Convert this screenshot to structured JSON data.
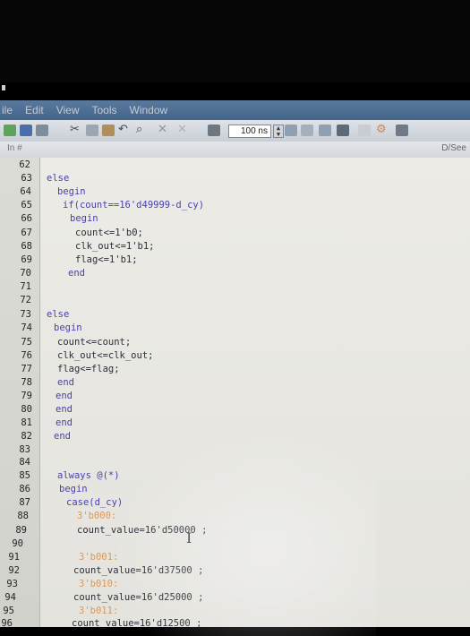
{
  "menubar": {
    "items": [
      "ile",
      "Edit",
      "View",
      "Tools",
      "Window"
    ]
  },
  "toolbar": {
    "time_value": "100 ns",
    "page_label": "D/See"
  },
  "pathbar": {
    "left": "In #"
  },
  "colors": {
    "keyword": "#4a3fb0",
    "number": "#b24a4a",
    "case_label": "#d79a5e",
    "editor_bg": "#ecebe6"
  },
  "editor": {
    "line_numbers": [
      "62",
      "63",
      "64",
      "65",
      "66",
      "67",
      "68",
      "69",
      "70",
      "71",
      "72",
      "73",
      "74",
      "75",
      "76",
      "77",
      "78",
      "79",
      "80",
      "81",
      "82",
      "83",
      "84",
      "85",
      "86",
      "87",
      "88",
      "89",
      "90",
      "91",
      "92",
      "93",
      "94",
      "95",
      "96"
    ],
    "lines": [
      "",
      "else",
      "begin",
      "if(count==16'd49999-d_cy)",
      "begin",
      "count<=1'b0;",
      "clk_out<=1'b1;",
      "flag<=1'b1;",
      "end",
      "",
      "",
      "else",
      "begin",
      "count<=count;",
      "clk_out<=clk_out;",
      "flag<=flag;",
      "end",
      "end",
      "end",
      "end",
      "end",
      "",
      "",
      "always @(*)",
      "begin",
      "case(d_cy)",
      "3'b000:",
      "count_value=16'd50000 ;",
      "",
      "3'b001:",
      "count_value=16'd37500 ;",
      "3'b010:",
      "count_value=16'd25000 ;",
      "3'b011:",
      "count_value=16'd12500 ;"
    ]
  }
}
